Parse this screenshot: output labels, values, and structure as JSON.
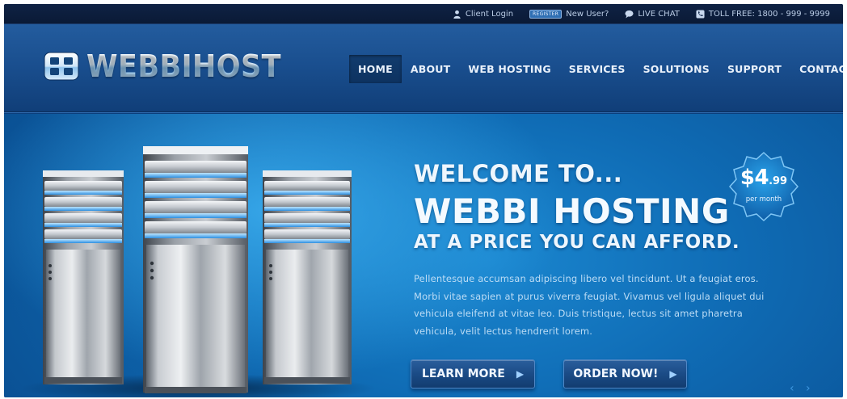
{
  "topbar": {
    "client_login": "Client Login",
    "register_badge": "REGISTER",
    "new_user": "New User?",
    "live_chat": "LIVE CHAT",
    "toll_free": "TOLL FREE: 1800 - 999 - 9999"
  },
  "header": {
    "logo_text": "WEBBIHOST",
    "nav": [
      {
        "label": "HOME",
        "active": true
      },
      {
        "label": "ABOUT"
      },
      {
        "label": "WEB HOSTING"
      },
      {
        "label": "SERVICES"
      },
      {
        "label": "SOLUTIONS"
      },
      {
        "label": "SUPPORT"
      },
      {
        "label": "CONTACT"
      }
    ]
  },
  "hero": {
    "welcome": "WELCOME TO...",
    "brand": "WEBBI HOSTING",
    "tagline": "AT A PRICE YOU CAN AFFORD.",
    "body": "Pellentesque accumsan adipiscing libero vel tincidunt. Ut a feugiat eros. Morbi vitae sapien at purus viverra feugiat. Vivamus vel ligula aliquet dui vehicula eleifend at vitae leo. Duis tristique, lectus sit amet pharetra vehicula, velit lectus hendrerit lorem.",
    "learn_more": "LEARN MORE",
    "order_now": "ORDER NOW!",
    "price_main": "$4",
    "price_cents": ".99",
    "price_period": "per month",
    "arrow_prev": "‹",
    "arrow_next": "›"
  },
  "icons": {
    "user": "user-icon",
    "chat": "chat-bubble-icon",
    "phone": "phone-icon",
    "logo": "grid-logo-icon"
  },
  "colors": {
    "topbar_bg": "#0a1a36",
    "header_bg": "#1a4f8f",
    "hero_bg": "#0f6bb4",
    "button_bg": "#1b4b86",
    "badge_bg": "#1e87d0"
  }
}
